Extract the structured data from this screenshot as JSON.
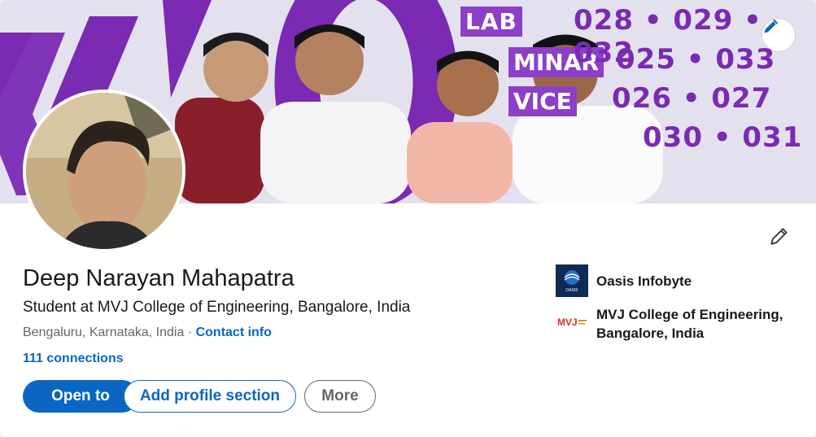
{
  "profile": {
    "name": "Deep Narayan Mahapatra",
    "headline": "Student at MVJ College of Engineering, Bangalore, India",
    "location": "Bengaluru, Karnataka, India",
    "separator": "·",
    "contact_info": "Contact info",
    "connections": "111 connections"
  },
  "actions": {
    "open_to": "Open to",
    "add_section": "Add profile section",
    "more": "More"
  },
  "organizations": [
    {
      "name": "Oasis Infobyte",
      "logo_text": "OASIS"
    },
    {
      "name_line1": "MVJ College of Engineering,",
      "name_line2": "Bangalore, India",
      "logo_text": "MVJ"
    }
  ],
  "banner": {
    "lab_label": "LAB",
    "sign_1": "MINAR",
    "sign_2": "VICE",
    "rooms_line1": "028 • 029 • 032",
    "rooms_line2": "025 • 033",
    "rooms_line3": "026 • 027",
    "rooms_line4": "030 • 031"
  },
  "colors": {
    "primary": "#0a66c2",
    "text": "#191919",
    "muted": "#666666",
    "banner_purple": "#7a2ab3"
  },
  "icons": {
    "edit_cover": "pencil-icon",
    "edit_intro": "pencil-icon"
  }
}
